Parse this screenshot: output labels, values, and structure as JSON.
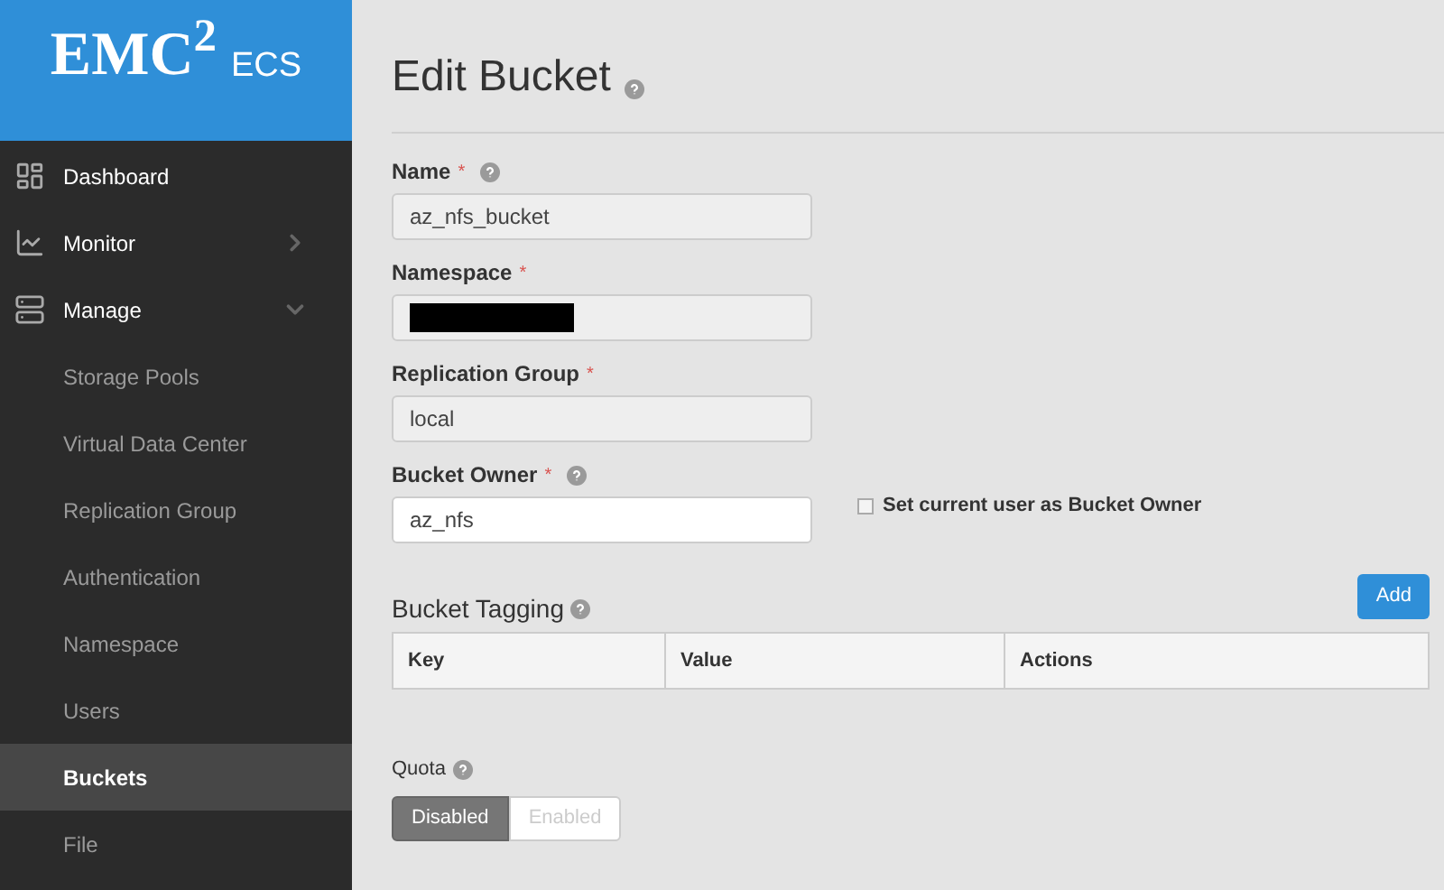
{
  "logo": {
    "brand": "EMC$^{2}$",
    "product": "ECS"
  },
  "sidebar": {
    "items": [
      {
        "kind": "top",
        "label": "Dashboard",
        "selected": false
      },
      {
        "kind": "top",
        "label": "Monitor",
        "selected": false,
        "expanded": false
      },
      {
        "kind": "top",
        "label": "Manage",
        "selected": false,
        "expanded": true
      },
      {
        "kind": "sub",
        "label": "Storage Pools",
        "selected": false
      },
      {
        "kind": "sub",
        "label": "Virtual Data Center",
        "selected": false
      },
      {
        "kind": "sub",
        "label": "Replication Group",
        "selected": false
      },
      {
        "kind": "sub",
        "label": "Authentication",
        "selected": false
      },
      {
        "kind": "sub",
        "label": "Namespace",
        "selected": false
      },
      {
        "kind": "sub",
        "label": "Users",
        "selected": false
      },
      {
        "kind": "sub",
        "label": "Buckets",
        "selected": true
      },
      {
        "kind": "sub",
        "label": "File",
        "selected": false
      }
    ]
  },
  "page": {
    "title": "Edit Bucket"
  },
  "fields": [
    {
      "label": "Name",
      "required_mark": "*",
      "help": true,
      "value": "az_nfs_bucket",
      "disabled": true,
      "redacted": false
    },
    {
      "label": "Namespace",
      "required_mark": "*",
      "help": false,
      "disabled": true,
      "redacted": true
    },
    {
      "label": "Replication Group",
      "required_mark": "*",
      "help": false,
      "value": "local",
      "disabled": true,
      "redacted": false
    },
    {
      "label": "Bucket Owner",
      "required_mark": "*",
      "help": true,
      "value": "az_nfs",
      "disabled": false,
      "redacted": false,
      "checkbox": {
        "label": "Set current user as Bucket Owner",
        "checked": false
      }
    }
  ],
  "tagging": {
    "title": "Bucket Tagging",
    "add_button": "Add",
    "columns": [
      "Key",
      "Value",
      "Actions"
    ]
  },
  "quota": {
    "label": "Quota",
    "options": [
      {
        "label": "Disabled",
        "selected": true
      },
      {
        "label": "Enabled",
        "selected": false
      }
    ]
  }
}
